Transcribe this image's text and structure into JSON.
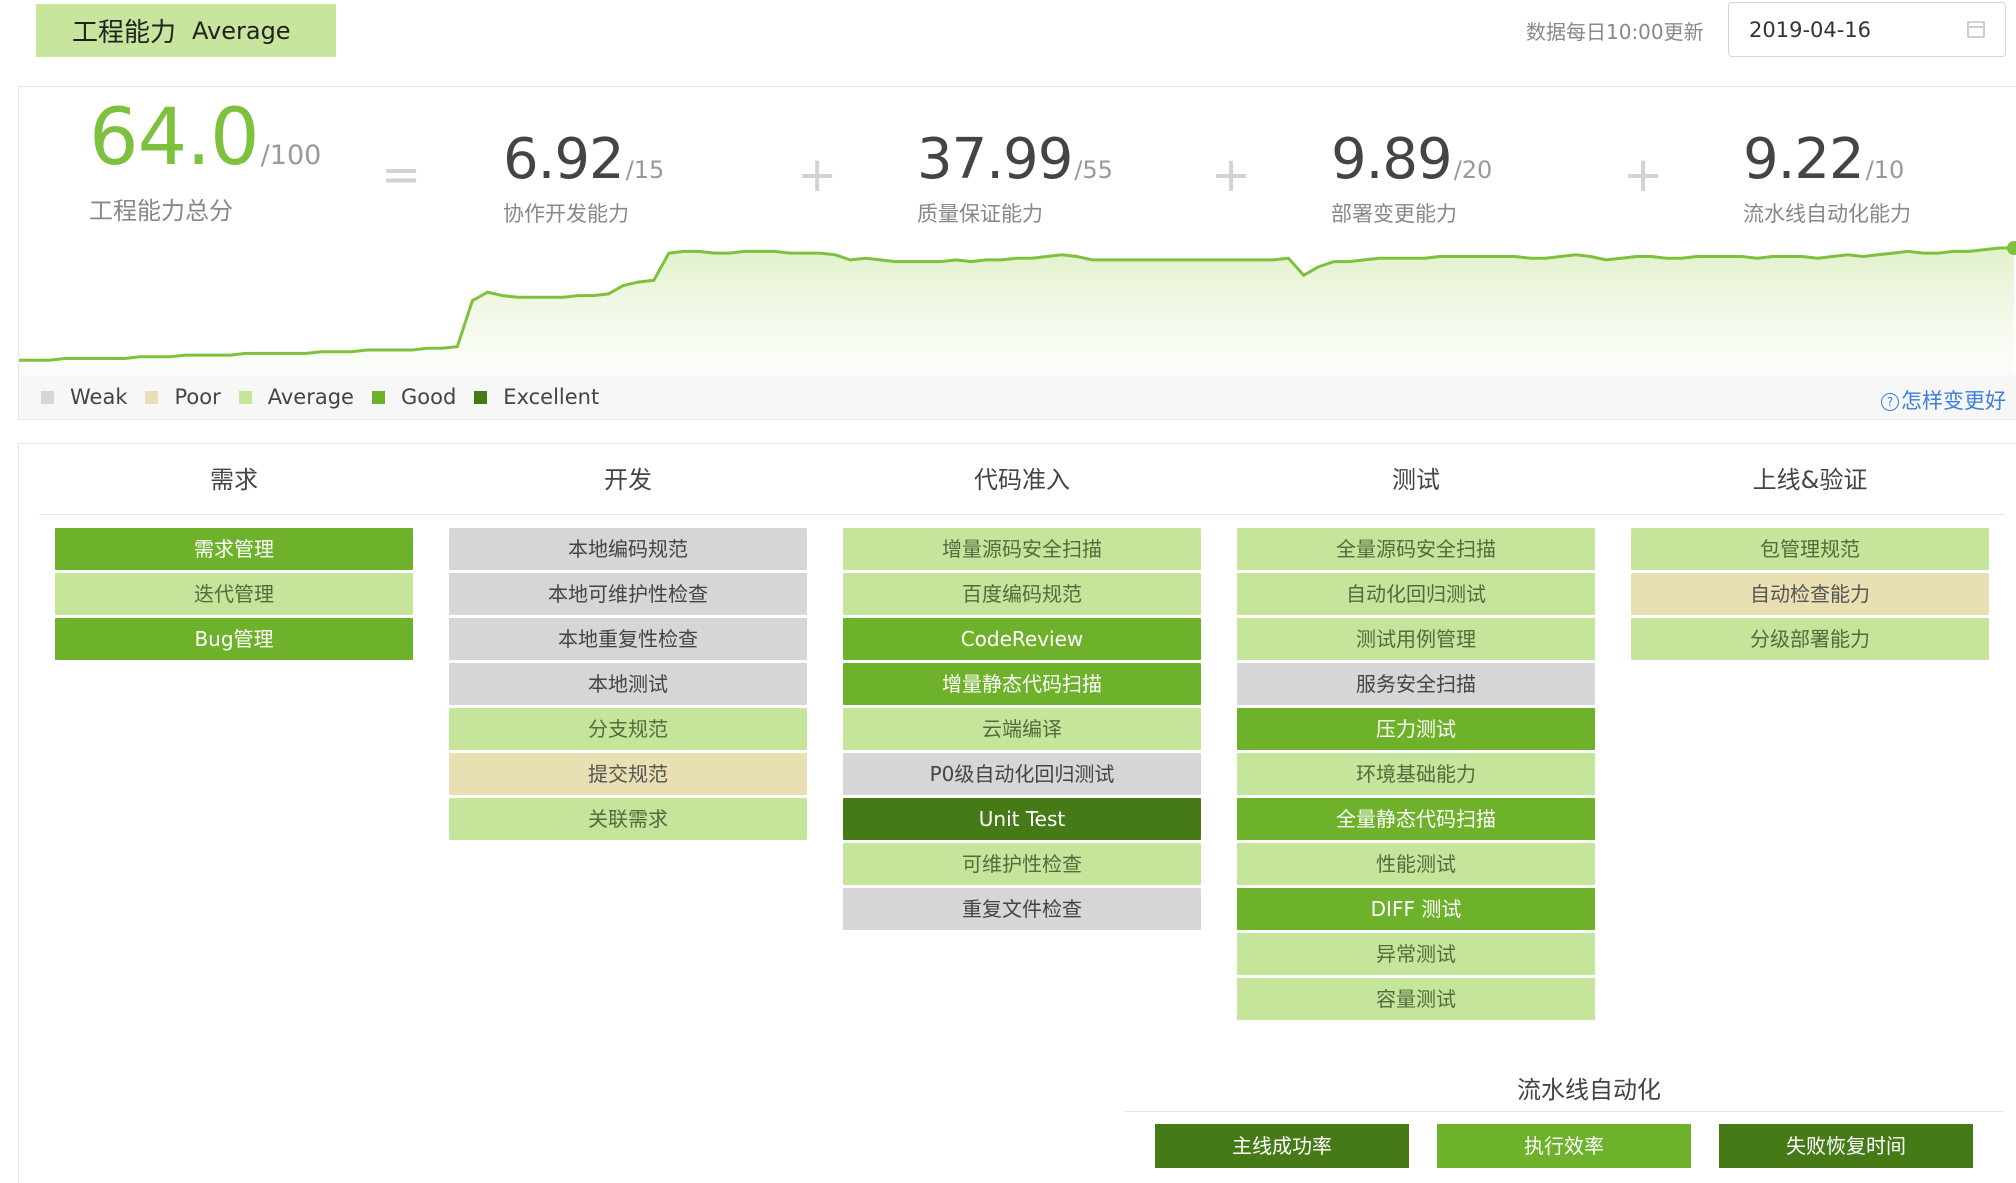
{
  "header": {
    "title": "工程能力",
    "level": "Average",
    "update_note": "数据每日10:00更新",
    "date": "2019-04-16",
    "date_icon": "calendar-icon"
  },
  "colors": {
    "weak": "#d6d6d6",
    "poor": "#e8dfb2",
    "average": "#c4e59a",
    "good": "#6db22a",
    "excellent": "#457a16",
    "trend_line": "#7ec13e"
  },
  "score": {
    "total": {
      "value": "64.0",
      "max": "/100",
      "label": "工程能力总分"
    },
    "equals": "=",
    "plus": "+",
    "metrics": [
      {
        "value": "6.92",
        "max": "/15",
        "label": "协作开发能力"
      },
      {
        "value": "37.99",
        "max": "/55",
        "label": "质量保证能力"
      },
      {
        "value": "9.89",
        "max": "/20",
        "label": "部署变更能力"
      },
      {
        "value": "9.22",
        "max": "/10",
        "label": "流水线自动化能力"
      }
    ]
  },
  "chart_data": {
    "type": "area",
    "title": "",
    "xlabel": "",
    "ylabel": "",
    "ylim": [
      0,
      100
    ],
    "grid": false,
    "series": [
      {
        "values": [
          4,
          4,
          4,
          5,
          5,
          5,
          5,
          5,
          6,
          6,
          6,
          7,
          7,
          7,
          7,
          8,
          8,
          8,
          8,
          8,
          9,
          9,
          9,
          10,
          10,
          10,
          10,
          11,
          11,
          12,
          39,
          44,
          42,
          41,
          41,
          41,
          41,
          42,
          42,
          43,
          48,
          50,
          51,
          67,
          68,
          68,
          67,
          67,
          68,
          68,
          68,
          67,
          67,
          67,
          66,
          63,
          64,
          63,
          62,
          62,
          62,
          62,
          63,
          62,
          63,
          63,
          64,
          64,
          65,
          66,
          65,
          63,
          63,
          63,
          63,
          63,
          63,
          63,
          63,
          63,
          63,
          63,
          63,
          63,
          64,
          54,
          59,
          62,
          62,
          63,
          64,
          64,
          64,
          64,
          65,
          65,
          65,
          65,
          65,
          65,
          64,
          64,
          65,
          66,
          65,
          63,
          64,
          65,
          65,
          64,
          64,
          65,
          65,
          65,
          65,
          64,
          65,
          65,
          65,
          64,
          65,
          66,
          65,
          66,
          67,
          68,
          67,
          67,
          68,
          68,
          69,
          70,
          70
        ]
      }
    ]
  },
  "legend": {
    "items": [
      {
        "label": "Weak",
        "color": "#d6d6d6"
      },
      {
        "label": "Poor",
        "color": "#e8dfb2"
      },
      {
        "label": "Average",
        "color": "#c4e59a"
      },
      {
        "label": "Good",
        "color": "#6db22a"
      },
      {
        "label": "Excellent",
        "color": "#457a16"
      }
    ],
    "help_text": "怎样变更好",
    "help_icon": "question-circle-icon",
    "help_glyph": "?"
  },
  "stages": [
    {
      "title": "需求",
      "items": [
        {
          "label": "需求管理",
          "level": "good"
        },
        {
          "label": "迭代管理",
          "level": "average"
        },
        {
          "label": "Bug管理",
          "level": "good"
        }
      ]
    },
    {
      "title": "开发",
      "items": [
        {
          "label": "本地编码规范",
          "level": "weak"
        },
        {
          "label": "本地可维护性检查",
          "level": "weak"
        },
        {
          "label": "本地重复性检查",
          "level": "weak"
        },
        {
          "label": "本地测试",
          "level": "weak"
        },
        {
          "label": "分支规范",
          "level": "average"
        },
        {
          "label": "提交规范",
          "level": "poor"
        },
        {
          "label": "关联需求",
          "level": "average"
        }
      ]
    },
    {
      "title": "代码准入",
      "items": [
        {
          "label": "增量源码安全扫描",
          "level": "average"
        },
        {
          "label": "百度编码规范",
          "level": "average"
        },
        {
          "label": "CodeReview",
          "level": "good"
        },
        {
          "label": "增量静态代码扫描",
          "level": "good"
        },
        {
          "label": "云端编译",
          "level": "average"
        },
        {
          "label": "P0级自动化回归测试",
          "level": "weak"
        },
        {
          "label": "Unit Test",
          "level": "excellent"
        },
        {
          "label": "可维护性检查",
          "level": "average"
        },
        {
          "label": "重复文件检查",
          "level": "weak"
        }
      ]
    },
    {
      "title": "测试",
      "items": [
        {
          "label": "全量源码安全扫描",
          "level": "average"
        },
        {
          "label": "自动化回归测试",
          "level": "average"
        },
        {
          "label": "测试用例管理",
          "level": "average"
        },
        {
          "label": "服务安全扫描",
          "level": "weak"
        },
        {
          "label": "压力测试",
          "level": "good"
        },
        {
          "label": "环境基础能力",
          "level": "average"
        },
        {
          "label": "全量静态代码扫描",
          "level": "good"
        },
        {
          "label": "性能测试",
          "level": "average"
        },
        {
          "label": "DIFF 测试",
          "level": "good"
        },
        {
          "label": "异常测试",
          "level": "average"
        },
        {
          "label": "容量测试",
          "level": "average"
        }
      ]
    },
    {
      "title": "上线&验证",
      "items": [
        {
          "label": "包管理规范",
          "level": "average"
        },
        {
          "label": "自动检查能力",
          "level": "poor"
        },
        {
          "label": "分级部署能力",
          "level": "average"
        }
      ]
    }
  ],
  "pipeline": {
    "title": "流水线自动化",
    "items": [
      {
        "label": "主线成功率",
        "level": "excellent"
      },
      {
        "label": "执行效率",
        "level": "good"
      },
      {
        "label": "失败恢复时间",
        "level": "excellent"
      }
    ]
  }
}
